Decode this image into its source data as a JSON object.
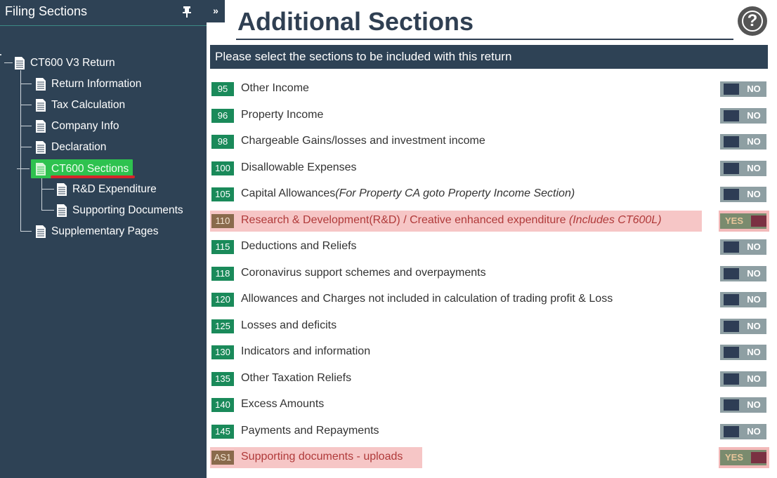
{
  "sidebar": {
    "title": "Filing Sections",
    "tree": {
      "root": "CT600 V3 Return",
      "items": [
        {
          "label": "Return Information"
        },
        {
          "label": "Tax Calculation"
        },
        {
          "label": "Company Info"
        },
        {
          "label": "Declaration"
        },
        {
          "label": "CT600 Sections",
          "selected": true
        },
        {
          "label": "R&D Expenditure"
        },
        {
          "label": "Supporting Documents"
        },
        {
          "label": "Supplementary Pages"
        }
      ]
    }
  },
  "collapse_label": "»",
  "main": {
    "title": "Additional Sections",
    "help_label": "?",
    "instruction": "Please select the sections to be included with this return",
    "sections": [
      {
        "code": "95",
        "label": "Other Income",
        "note": "",
        "value": "NO"
      },
      {
        "code": "96",
        "label": "Property Income",
        "note": "",
        "value": "NO"
      },
      {
        "code": "98",
        "label": "Chargeable Gains/losses and investment income",
        "note": "",
        "value": "NO"
      },
      {
        "code": "100",
        "label": "Disallowable Expenses",
        "note": "",
        "value": "NO"
      },
      {
        "code": "105",
        "label": "Capital Allowances",
        "note": "(For Property CA goto Property Income Section)",
        "value": "NO"
      },
      {
        "code": "110",
        "label": "Research & Development(R&D) / Creative enhanced expenditure ",
        "note": "(Includes CT600L)",
        "value": "YES"
      },
      {
        "code": "115",
        "label": "Deductions and Reliefs",
        "note": "",
        "value": "NO"
      },
      {
        "code": "118",
        "label": "Coronavirus support schemes and overpayments",
        "note": "",
        "value": "NO"
      },
      {
        "code": "120",
        "label": "Allowances and Charges not included in calculation of trading profit & Loss",
        "note": "",
        "value": "NO"
      },
      {
        "code": "125",
        "label": "Losses and deficits",
        "note": "",
        "value": "NO"
      },
      {
        "code": "130",
        "label": "Indicators and information",
        "note": "",
        "value": "NO"
      },
      {
        "code": "135",
        "label": "Other Taxation Reliefs",
        "note": "",
        "value": "NO"
      },
      {
        "code": "140",
        "label": "Excess Amounts",
        "note": "",
        "value": "NO"
      },
      {
        "code": "145",
        "label": "Payments and Repayments",
        "note": "",
        "value": "NO"
      },
      {
        "code": "AS1",
        "label": "Supporting documents - uploads",
        "note": "",
        "value": "YES"
      }
    ]
  },
  "colors": {
    "sidebar_bg": "#2e4255",
    "selected_green": "#2ec24f",
    "code_green": "#1a8a5a",
    "highlight_pink": "#f6c6c6",
    "underline_red": "#d8232a"
  }
}
